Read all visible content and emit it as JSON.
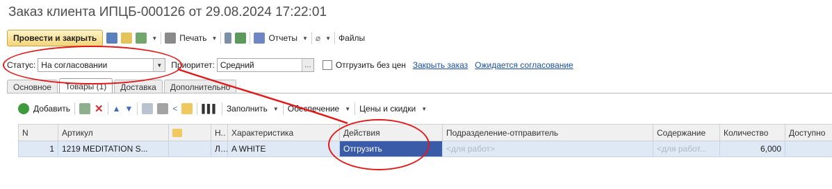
{
  "title": "Заказ клиента ИПЦБ-000126 от 29.08.2024 17:22:01",
  "toolbar": {
    "post_close": "Провести и закрыть",
    "print": "Печать",
    "reports": "Отчеты",
    "files": "Файлы"
  },
  "status": {
    "label": "Статус:",
    "value": "На согласовании",
    "priority_label": "Приоритет:",
    "priority_value": "Средний",
    "ship_no_prices": "Отгрузить без цен",
    "close_order": "Закрыть заказ",
    "awaiting": "Ожидается согласование"
  },
  "tabs": [
    "Основное",
    "Товары (1)",
    "Доставка",
    "Дополнительно"
  ],
  "grid_toolbar": {
    "add": "Добавить",
    "fill": "Заполнить",
    "supply": "Обеспечение",
    "prices": "Цены и скидки"
  },
  "grid": {
    "columns": [
      "N",
      "Артикул",
      "",
      "Н..",
      "Характеристика",
      "Действия",
      "Подразделение-отправитель",
      "Содержание",
      "Количество",
      "Доступно"
    ],
    "rows": [
      [
        "1",
        "1219 MEDITATION S...",
        "",
        "Л..",
        "A WHITE",
        "Отгрузить",
        "<для работ>",
        "<для работ...",
        "6,000",
        ""
      ]
    ]
  },
  "colors": {
    "selected": "#3a5ca8",
    "annotation": "#e01a1a",
    "link": "#1b4fa0"
  }
}
